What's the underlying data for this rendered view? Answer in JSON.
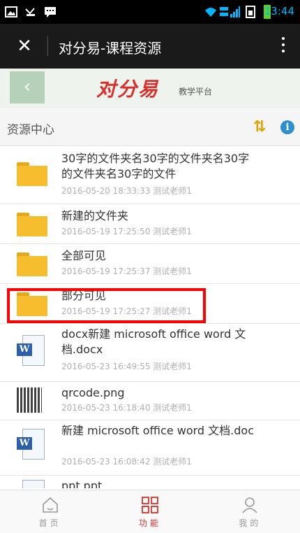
{
  "status_bar": {
    "time": "13:44",
    "signal_label": "2G 1X"
  },
  "title_bar": {
    "title": "对分易-课程资源",
    "close_icon": "close-icon",
    "menu_icon": "more-vertical-icon"
  },
  "logo_bar": {
    "logo_text": "对分易",
    "logo_sub": "教学平台"
  },
  "resource_header": {
    "title": "资源中心",
    "sort_icon": "sort-icon",
    "info_icon": "info-icon"
  },
  "files": [
    {
      "type": "folder",
      "name": "30字的文件夹名30字的文件夹名30字的文件夹名30字的文件",
      "date": "2016-05-20 18:33:33",
      "author": "测试老师1"
    },
    {
      "type": "folder",
      "name": "新建的文件夹",
      "date": "2016-05-19 17:25:50",
      "author": "测试老师1"
    },
    {
      "type": "folder",
      "name": "全部可见",
      "date": "2016-05-19 17:25:37",
      "author": "测试老师1"
    },
    {
      "type": "folder",
      "name": "部分可见",
      "date": "2016-05-19 17:25:27",
      "author": "测试老师1"
    },
    {
      "type": "word",
      "name": "docx新建 microsoft office word 文档.docx",
      "date": "2016-05-23 16:49:55",
      "author": "测试老师1"
    },
    {
      "type": "image",
      "name": "qrcode.png",
      "date": "2016-05-23 16:18:40",
      "author": "测试老师1"
    },
    {
      "type": "word",
      "name": "新建 microsoft office word 文档.doc",
      "date": "2016-05-23 16:08:42",
      "author": "测试老师1"
    },
    {
      "type": "ppt",
      "name": "ppt.ppt",
      "date": "",
      "author": ""
    }
  ],
  "bottom_nav": [
    {
      "label": "首页",
      "icon": "home-icon",
      "active": false
    },
    {
      "label": "功能",
      "icon": "grid-icon",
      "active": true
    },
    {
      "label": "我的",
      "icon": "user-icon",
      "active": false
    }
  ],
  "colors": {
    "accent_red": "#d9302c",
    "folder_yellow": "#f6be2e",
    "highlight": "#ff0000",
    "nav_active": "#d9302c",
    "nav_inactive": "#999999"
  }
}
